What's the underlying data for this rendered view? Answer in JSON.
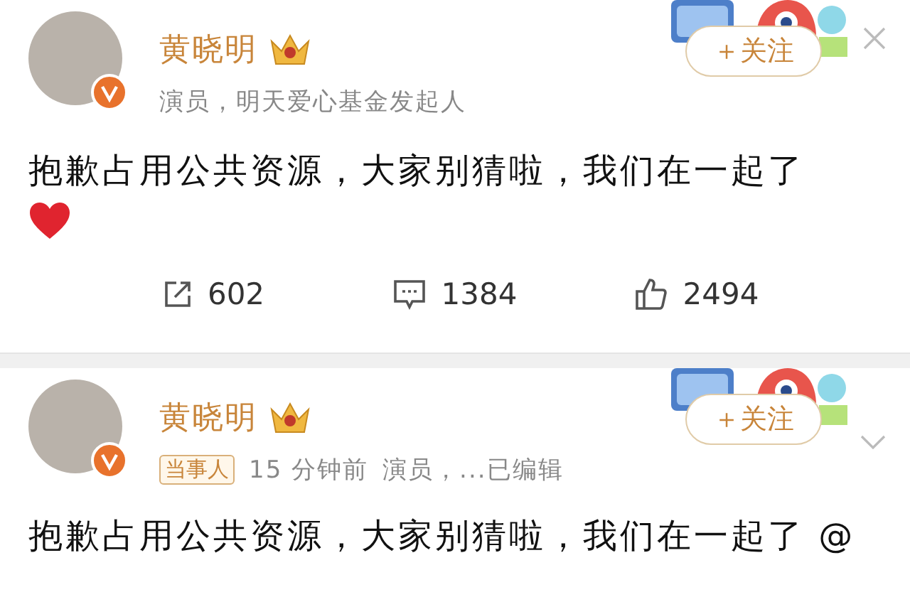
{
  "posts": [
    {
      "author": "黄晓明",
      "bio": "演员，明天爱心基金发起人",
      "follow": "＋关注",
      "dismissable": true,
      "text": "抱歉占用公共资源，大家别猜啦，我们在一起了",
      "heart": true,
      "stats": [
        {
          "kind": "repost",
          "count": "602"
        },
        {
          "kind": "comment",
          "count": "1384"
        },
        {
          "kind": "like",
          "count": "2494"
        }
      ]
    },
    {
      "author": "黄晓明",
      "tag": "当事人",
      "time": "15 分钟前",
      "meta": "演员，...已编辑",
      "follow": "＋关注",
      "dismissable": false,
      "text": "抱歉占用公共资源，大家别猜啦，我们在一起了 @"
    }
  ]
}
